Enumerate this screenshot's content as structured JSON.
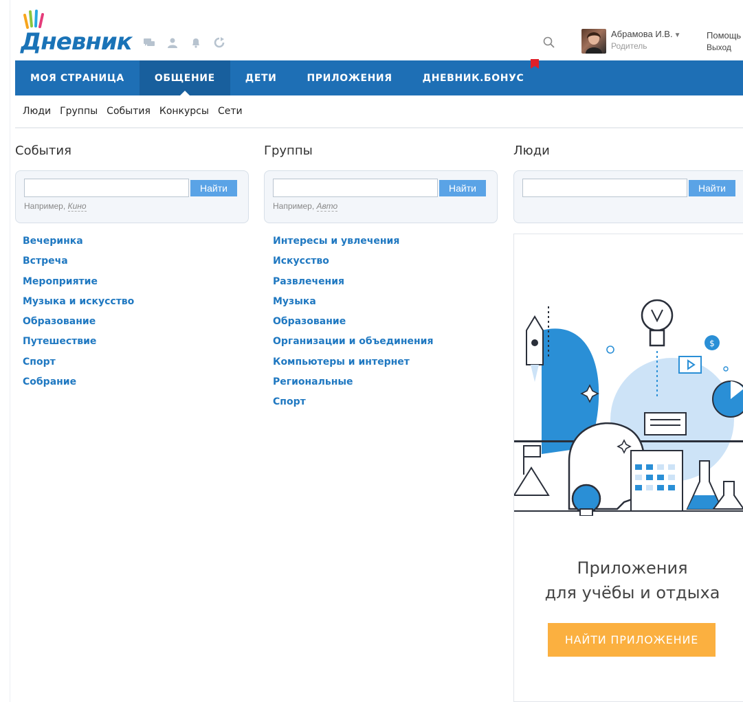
{
  "header": {
    "logo_text": "Дневник",
    "user": {
      "name": "Абрамова И.В.",
      "role": "Родитель"
    },
    "help_label": "Помощь",
    "exit_label": "Выход",
    "icons": [
      "chat-icon",
      "user-icon",
      "bell-icon",
      "refresh-icon",
      "search-icon"
    ]
  },
  "main_nav": {
    "items": [
      {
        "label": "МОЯ СТРАНИЦА",
        "active": false
      },
      {
        "label": "ОБЩЕНИЕ",
        "active": true
      },
      {
        "label": "ДЕТИ",
        "active": false
      },
      {
        "label": "ПРИЛОЖЕНИЯ",
        "active": false
      },
      {
        "label": "ДНЕВНИК.БОНУС",
        "active": false
      }
    ]
  },
  "sub_nav": {
    "items": [
      "Люди",
      "Группы",
      "События",
      "Конкурсы",
      "Сети"
    ]
  },
  "columns": {
    "events": {
      "title": "События",
      "search_button": "Найти",
      "example_prefix": "Например,",
      "example_word": "Кино",
      "categories": [
        "Вечеринка",
        "Встреча",
        "Мероприятие",
        "Музыка и искусство",
        "Образование",
        "Путешествие",
        "Спорт",
        "Собрание"
      ]
    },
    "groups": {
      "title": "Группы",
      "search_button": "Найти",
      "example_prefix": "Например,",
      "example_word": "Авто",
      "categories": [
        "Интересы и увлечения",
        "Искусство",
        "Развлечения",
        "Музыка",
        "Образование",
        "Организации и объединения",
        "Компьютеры и интернет",
        "Региональные",
        "Спорт"
      ]
    },
    "people": {
      "title": "Люди",
      "search_button": "Найти"
    }
  },
  "promo": {
    "title": "Приложения",
    "subtitle": "для учёбы и отдыха",
    "button_label": "НАЙТИ ПРИЛОЖЕНИЕ",
    "accent_color": "#fbb040"
  },
  "colors": {
    "nav_bg": "#1e6fb5",
    "nav_active_bg": "#185f9d",
    "link": "#1f78c1",
    "search_button": "#5aa3e6"
  }
}
